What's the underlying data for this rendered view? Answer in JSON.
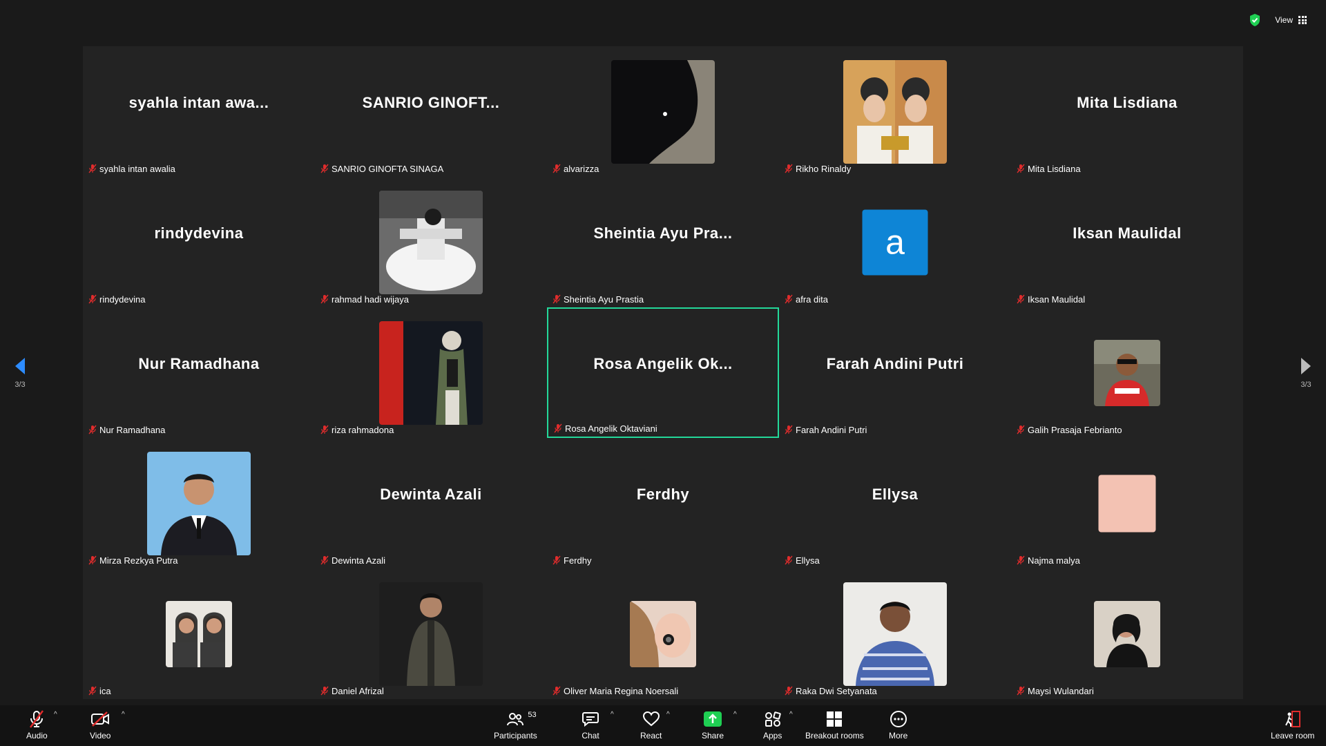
{
  "view": {
    "label": "View"
  },
  "pager": {
    "indicator": "3/3"
  },
  "tiles": [
    {
      "big": "syahla intan awa...",
      "label": "syahla intan awalia"
    },
    {
      "big": "SANRIO GINOFT...",
      "label": "SANRIO GINOFTA SINAGA"
    },
    {
      "big": "",
      "label": "alvarizza"
    },
    {
      "big": "",
      "label": "Rikho Rinaldy"
    },
    {
      "big": "Mita Lisdiana",
      "label": "Mita Lisdiana"
    },
    {
      "big": "rindydevina",
      "label": "rindydevina"
    },
    {
      "big": "",
      "label": "rahmad hadi wijaya"
    },
    {
      "big": "Sheintia Ayu Pra...",
      "label": "Sheintia Ayu Prastia"
    },
    {
      "big": "",
      "label": "afra dita",
      "initial": "a"
    },
    {
      "big": "Iksan Maulidal",
      "label": "Iksan Maulidal"
    },
    {
      "big": "Nur Ramadhana",
      "label": "Nur Ramadhana"
    },
    {
      "big": "",
      "label": "riza rahmadona"
    },
    {
      "big": "Rosa Angelik Ok...",
      "label": "Rosa Angelik Oktaviani"
    },
    {
      "big": "Farah Andini Putri",
      "label": "Farah Andini Putri"
    },
    {
      "big": "",
      "label": "Galih Prasaja Febrianto"
    },
    {
      "big": "",
      "label": "Mirza Rezkya Putra"
    },
    {
      "big": "Dewinta Azali",
      "label": "Dewinta Azali"
    },
    {
      "big": "Ferdhy",
      "label": "Ferdhy"
    },
    {
      "big": "Ellysa",
      "label": "Ellysa"
    },
    {
      "big": "",
      "label": "Najma malya"
    },
    {
      "big": "",
      "label": "ica"
    },
    {
      "big": "",
      "label": "Daniel Afrizal"
    },
    {
      "big": "",
      "label": "Oliver Maria Regina Noersali"
    },
    {
      "big": "",
      "label": "Raka Dwi Setyanata"
    },
    {
      "big": "",
      "label": "Maysi Wulandari"
    }
  ],
  "toolbar": {
    "audio": "Audio",
    "video": "Video",
    "participants": "Participants",
    "participants_count": "53",
    "chat": "Chat",
    "react": "React",
    "share": "Share",
    "apps": "Apps",
    "breakout": "Breakout rooms",
    "more": "More",
    "leave": "Leave room"
  },
  "colors": {
    "active_speaker": "#23d89a",
    "share": "#1fcf53",
    "avatar": "#0e85d6",
    "mic_off": "#e02c2c"
  }
}
